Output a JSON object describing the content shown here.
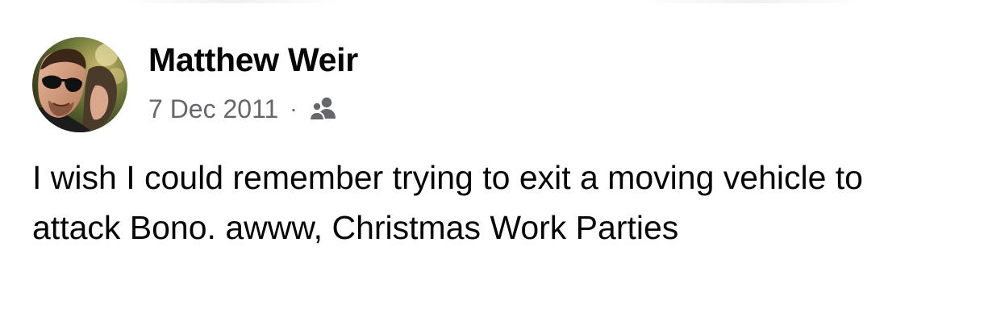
{
  "post": {
    "author_name": "Matthew Weir",
    "date": "7 Dec 2011",
    "separator": "·",
    "audience_icon": "friends-icon",
    "avatar_icon": "profile-photo",
    "text": "I wish I could remember trying to exit a moving vehicle to attack Bono. awww, Christmas Work Parties"
  },
  "colors": {
    "text_primary": "#050505",
    "text_secondary": "#65676b",
    "background": "#ffffff"
  }
}
